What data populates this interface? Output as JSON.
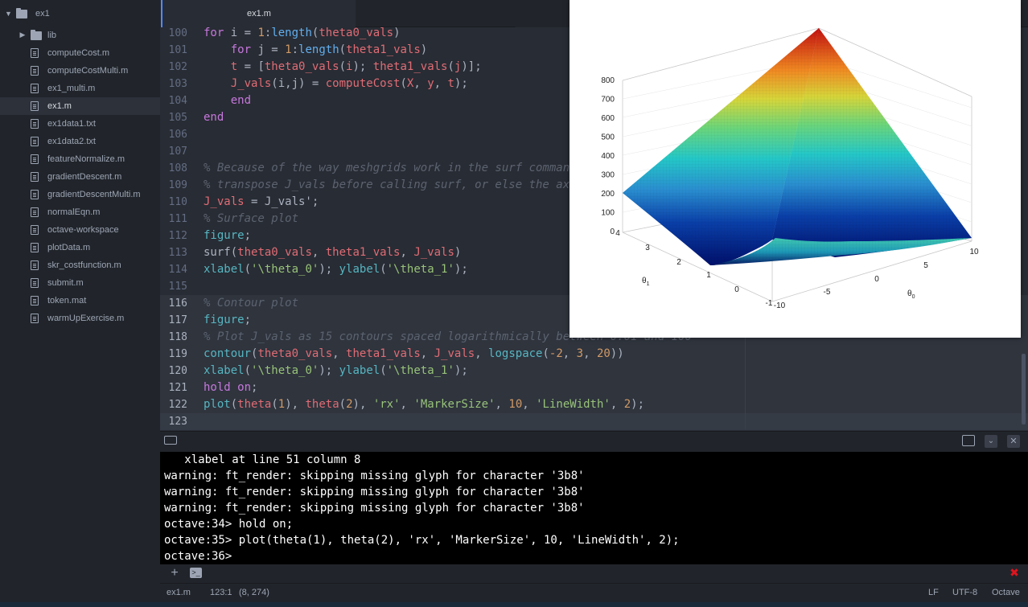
{
  "sidebar": {
    "root": "ex1",
    "folder": "lib",
    "files": [
      "computeCost.m",
      "computeCostMulti.m",
      "ex1_multi.m",
      "ex1.m",
      "ex1data1.txt",
      "ex1data2.txt",
      "featureNormalize.m",
      "gradientDescent.m",
      "gradientDescentMulti.m",
      "normalEqn.m",
      "octave-workspace",
      "plotData.m",
      "skr_costfunction.m",
      "submit.m",
      "token.mat",
      "warmUpExercise.m"
    ],
    "selected": "ex1.m"
  },
  "tab": {
    "title": "ex1.m"
  },
  "editor": {
    "line_numbers": [
      "100",
      "101",
      "102",
      "103",
      "104",
      "105",
      "106",
      "107",
      "108",
      "109",
      "110",
      "111",
      "112",
      "113",
      "114",
      "115",
      "116",
      "117",
      "118",
      "119",
      "120",
      "121",
      "122",
      "123"
    ]
  },
  "figure": {
    "z_ticks": [
      "800",
      "700",
      "600",
      "500",
      "400",
      "300",
      "200",
      "100",
      "0"
    ],
    "theta1_ticks": [
      "4",
      "3",
      "2",
      "1",
      "0",
      "-1"
    ],
    "theta0_ticks": [
      "-10",
      "-5",
      "0",
      "5",
      "10"
    ],
    "xlabel": "θ",
    "xlabel_sub": "0",
    "ylabel": "θ",
    "ylabel_sub": "1"
  },
  "console": {
    "lines": [
      "   xlabel at line 51 column 8",
      "warning: ft_render: skipping missing glyph for character '3b8'",
      "warning: ft_render: skipping missing glyph for character '3b8'",
      "warning: ft_render: skipping missing glyph for character '3b8'",
      "octave:34> hold on;",
      "octave:35> plot(theta(1), theta(2), 'rx', 'MarkerSize', 10, 'LineWidth', 2);",
      "octave:36>"
    ]
  },
  "status": {
    "file": "ex1.m",
    "cursor": "123:1",
    "selection": "(8, 274)",
    "line_ending": "LF",
    "encoding": "UTF-8",
    "grammar": "Octave"
  },
  "icons": {
    "add": "+",
    "close": "✖"
  },
  "colors": {
    "accent": "#528bff",
    "close_red": "#e0141e"
  }
}
